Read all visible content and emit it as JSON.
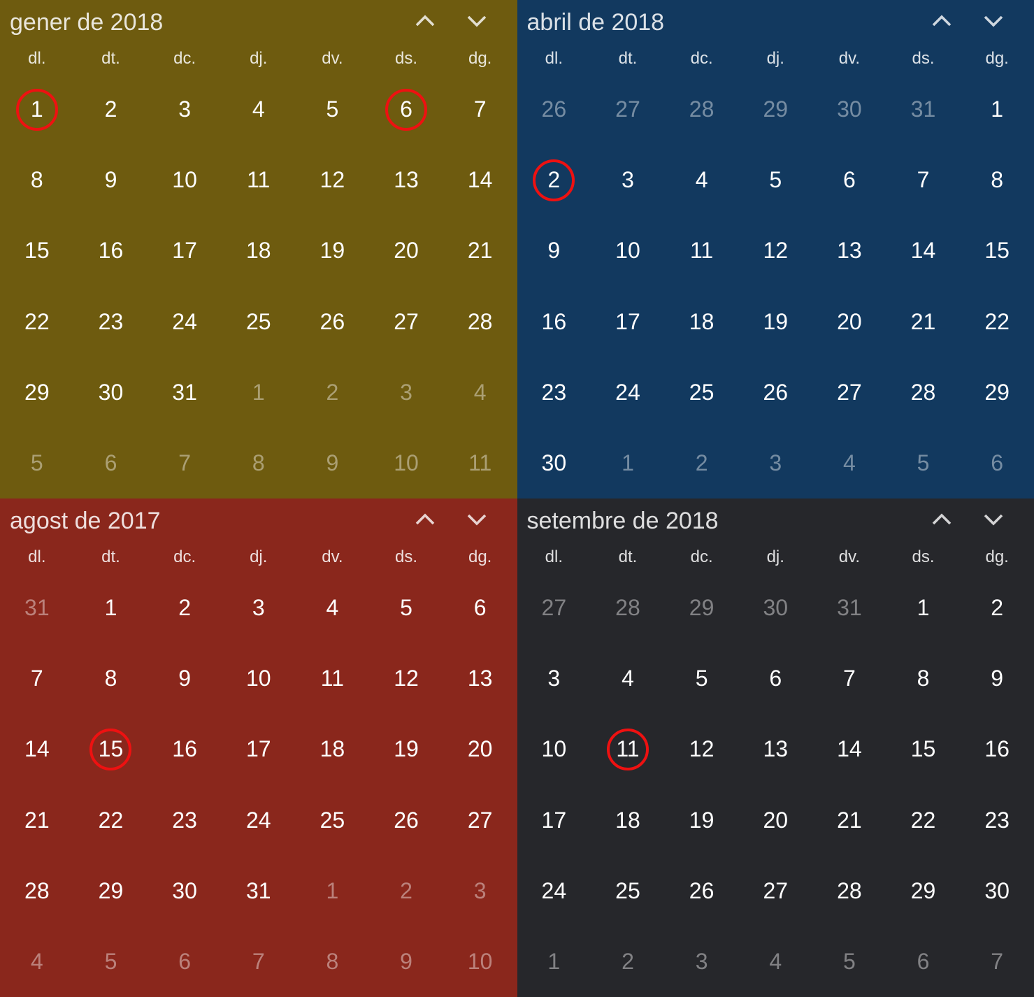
{
  "day_headers": [
    "dl.",
    "dt.",
    "dc.",
    "dj.",
    "dv.",
    "ds.",
    "dg."
  ],
  "calendars": [
    {
      "id": "gener-2018",
      "title": "gener de 2018",
      "bg": "#6e5b0f",
      "cells": [
        {
          "n": "1",
          "circled": true
        },
        {
          "n": "2"
        },
        {
          "n": "3"
        },
        {
          "n": "4"
        },
        {
          "n": "5"
        },
        {
          "n": "6",
          "circled": true
        },
        {
          "n": "7"
        },
        {
          "n": "8"
        },
        {
          "n": "9"
        },
        {
          "n": "10"
        },
        {
          "n": "11"
        },
        {
          "n": "12"
        },
        {
          "n": "13"
        },
        {
          "n": "14"
        },
        {
          "n": "15"
        },
        {
          "n": "16"
        },
        {
          "n": "17"
        },
        {
          "n": "18"
        },
        {
          "n": "19"
        },
        {
          "n": "20"
        },
        {
          "n": "21"
        },
        {
          "n": "22"
        },
        {
          "n": "23"
        },
        {
          "n": "24"
        },
        {
          "n": "25"
        },
        {
          "n": "26"
        },
        {
          "n": "27"
        },
        {
          "n": "28"
        },
        {
          "n": "29"
        },
        {
          "n": "30"
        },
        {
          "n": "31"
        },
        {
          "n": "1",
          "dim": true
        },
        {
          "n": "2",
          "dim": true
        },
        {
          "n": "3",
          "dim": true
        },
        {
          "n": "4",
          "dim": true
        },
        {
          "n": "5",
          "dim": true
        },
        {
          "n": "6",
          "dim": true
        },
        {
          "n": "7",
          "dim": true
        },
        {
          "n": "8",
          "dim": true
        },
        {
          "n": "9",
          "dim": true
        },
        {
          "n": "10",
          "dim": true
        },
        {
          "n": "11",
          "dim": true
        }
      ]
    },
    {
      "id": "abril-2018",
      "title": "abril de 2018",
      "bg": "#12395f",
      "cells": [
        {
          "n": "26",
          "dim": true
        },
        {
          "n": "27",
          "dim": true
        },
        {
          "n": "28",
          "dim": true
        },
        {
          "n": "29",
          "dim": true
        },
        {
          "n": "30",
          "dim": true
        },
        {
          "n": "31",
          "dim": true
        },
        {
          "n": "1"
        },
        {
          "n": "2",
          "circled": true
        },
        {
          "n": "3"
        },
        {
          "n": "4"
        },
        {
          "n": "5"
        },
        {
          "n": "6"
        },
        {
          "n": "7"
        },
        {
          "n": "8"
        },
        {
          "n": "9"
        },
        {
          "n": "10"
        },
        {
          "n": "11"
        },
        {
          "n": "12"
        },
        {
          "n": "13"
        },
        {
          "n": "14"
        },
        {
          "n": "15"
        },
        {
          "n": "16"
        },
        {
          "n": "17"
        },
        {
          "n": "18"
        },
        {
          "n": "19"
        },
        {
          "n": "20"
        },
        {
          "n": "21"
        },
        {
          "n": "22"
        },
        {
          "n": "23"
        },
        {
          "n": "24"
        },
        {
          "n": "25"
        },
        {
          "n": "26"
        },
        {
          "n": "27"
        },
        {
          "n": "28"
        },
        {
          "n": "29"
        },
        {
          "n": "30"
        },
        {
          "n": "1",
          "dim": true
        },
        {
          "n": "2",
          "dim": true
        },
        {
          "n": "3",
          "dim": true
        },
        {
          "n": "4",
          "dim": true
        },
        {
          "n": "5",
          "dim": true
        },
        {
          "n": "6",
          "dim": true
        }
      ]
    },
    {
      "id": "agost-2017",
      "title": "agost de 2017",
      "bg": "#8a271c",
      "cells": [
        {
          "n": "31",
          "dim": true
        },
        {
          "n": "1"
        },
        {
          "n": "2"
        },
        {
          "n": "3"
        },
        {
          "n": "4"
        },
        {
          "n": "5"
        },
        {
          "n": "6"
        },
        {
          "n": "7"
        },
        {
          "n": "8"
        },
        {
          "n": "9"
        },
        {
          "n": "10"
        },
        {
          "n": "11"
        },
        {
          "n": "12"
        },
        {
          "n": "13"
        },
        {
          "n": "14"
        },
        {
          "n": "15",
          "circled": true
        },
        {
          "n": "16"
        },
        {
          "n": "17"
        },
        {
          "n": "18"
        },
        {
          "n": "19"
        },
        {
          "n": "20"
        },
        {
          "n": "21"
        },
        {
          "n": "22"
        },
        {
          "n": "23"
        },
        {
          "n": "24"
        },
        {
          "n": "25"
        },
        {
          "n": "26"
        },
        {
          "n": "27"
        },
        {
          "n": "28"
        },
        {
          "n": "29"
        },
        {
          "n": "30"
        },
        {
          "n": "31"
        },
        {
          "n": "1",
          "dim": true
        },
        {
          "n": "2",
          "dim": true
        },
        {
          "n": "3",
          "dim": true
        },
        {
          "n": "4",
          "dim": true
        },
        {
          "n": "5",
          "dim": true
        },
        {
          "n": "6",
          "dim": true
        },
        {
          "n": "7",
          "dim": true
        },
        {
          "n": "8",
          "dim": true
        },
        {
          "n": "9",
          "dim": true
        },
        {
          "n": "10",
          "dim": true
        }
      ]
    },
    {
      "id": "setembre-2018",
      "title": "setembre de 2018",
      "bg": "#26272b",
      "cells": [
        {
          "n": "27",
          "dim": true
        },
        {
          "n": "28",
          "dim": true
        },
        {
          "n": "29",
          "dim": true
        },
        {
          "n": "30",
          "dim": true
        },
        {
          "n": "31",
          "dim": true
        },
        {
          "n": "1"
        },
        {
          "n": "2"
        },
        {
          "n": "3"
        },
        {
          "n": "4"
        },
        {
          "n": "5"
        },
        {
          "n": "6"
        },
        {
          "n": "7"
        },
        {
          "n": "8"
        },
        {
          "n": "9"
        },
        {
          "n": "10"
        },
        {
          "n": "11",
          "circled": true
        },
        {
          "n": "12"
        },
        {
          "n": "13"
        },
        {
          "n": "14"
        },
        {
          "n": "15"
        },
        {
          "n": "16"
        },
        {
          "n": "17"
        },
        {
          "n": "18"
        },
        {
          "n": "19"
        },
        {
          "n": "20"
        },
        {
          "n": "21"
        },
        {
          "n": "22"
        },
        {
          "n": "23"
        },
        {
          "n": "24"
        },
        {
          "n": "25"
        },
        {
          "n": "26"
        },
        {
          "n": "27"
        },
        {
          "n": "28"
        },
        {
          "n": "29"
        },
        {
          "n": "30"
        },
        {
          "n": "1",
          "dim": true
        },
        {
          "n": "2",
          "dim": true
        },
        {
          "n": "3",
          "dim": true
        },
        {
          "n": "4",
          "dim": true
        },
        {
          "n": "5",
          "dim": true
        },
        {
          "n": "6",
          "dim": true
        },
        {
          "n": "7",
          "dim": true
        }
      ]
    }
  ]
}
